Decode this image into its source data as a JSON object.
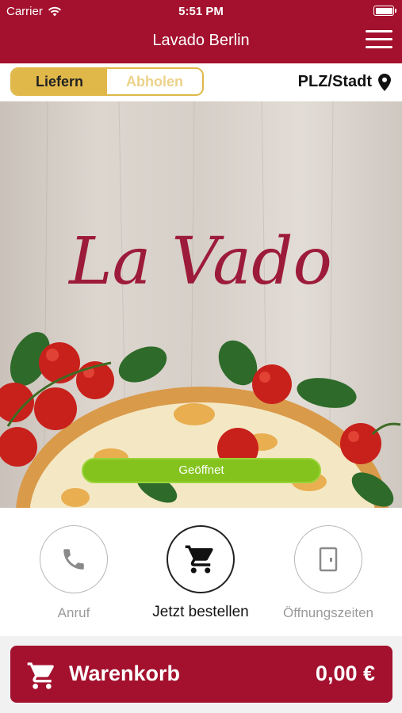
{
  "status_bar": {
    "carrier": "Carrier",
    "time": "5:51 PM"
  },
  "header": {
    "title": "Lavado Berlin"
  },
  "order_mode": {
    "deliver_label": "Liefern",
    "pickup_label": "Abholen",
    "selected": "deliver"
  },
  "location": {
    "label": "PLZ/Stadt"
  },
  "hero": {
    "logo_text": "La Vado",
    "open_status": "Geöffnet"
  },
  "actions": {
    "call_label": "Anruf",
    "order_label": "Jetzt bestellen",
    "hours_label": "Öffnungszeiten"
  },
  "cart": {
    "label": "Warenkorb",
    "total": "0,00 €"
  },
  "colors": {
    "brand": "#a3112e",
    "accent_gold": "#e0b84a",
    "open_green": "#84c31d"
  },
  "icons": [
    "wifi-icon",
    "battery-icon",
    "hamburger-menu-icon",
    "map-pin-icon",
    "phone-icon",
    "shopping-cart-icon",
    "door-icon"
  ]
}
